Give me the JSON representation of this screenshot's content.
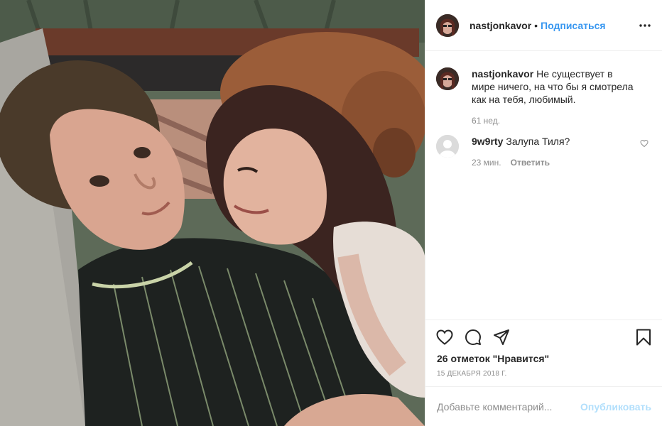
{
  "header": {
    "username": "nastjonkavor",
    "separator": "•",
    "follow_label": "Подписаться",
    "avatar_icon": "user-avatar",
    "more_icon": "more-horizontal-icon"
  },
  "caption": {
    "username": "nastjonkavor",
    "text": "Не существует в мире ничего, на что бы я смотрела как на тебя, любимый.",
    "time": "61 нед."
  },
  "comments": [
    {
      "username": "9w9rty",
      "text": "Залупа Тиля?",
      "time": "23 мин.",
      "reply_label": "Ответить",
      "like_icon": "heart-outline-icon"
    }
  ],
  "actions": {
    "like_icon": "heart-outline-icon",
    "comment_icon": "speech-bubble-icon",
    "share_icon": "paper-plane-icon",
    "save_icon": "bookmark-icon"
  },
  "likes_text": "26 отметок \"Нравится\"",
  "date": "15 ДЕКАБРЯ 2018 Г.",
  "add_comment": {
    "placeholder": "Добавьте комментарий...",
    "publish_label": "Опубликовать"
  },
  "colors": {
    "accent": "#3897f0",
    "publish_disabled": "#b2dffc",
    "meta": "#8e8e8e",
    "border": "#efefef"
  }
}
